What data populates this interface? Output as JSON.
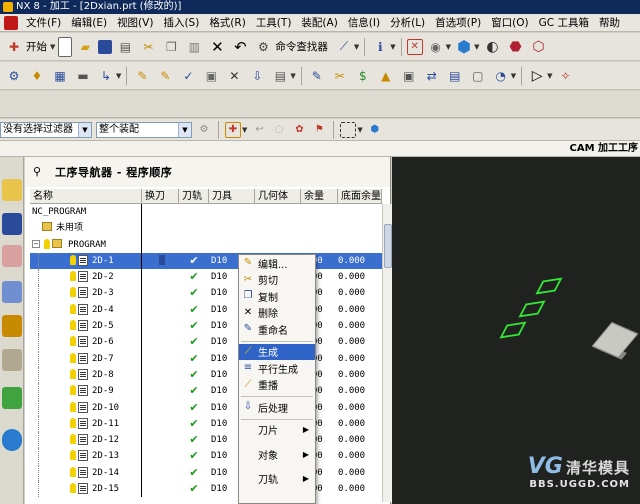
{
  "window": {
    "title": "NX 8 - 加工 - [2Dxian.prt (修改的)]"
  },
  "menubar": {
    "items": [
      "文件(F)",
      "编辑(E)",
      "视图(V)",
      "插入(S)",
      "格式(R)",
      "工具(T)",
      "装配(A)",
      "信息(I)",
      "分析(L)",
      "首选项(P)",
      "窗口(O)",
      "GC 工具箱",
      "帮助"
    ]
  },
  "toolbar": {
    "start_label": "开始",
    "command_finder_label": "命令查找器"
  },
  "filterbar": {
    "selection_filter": "没有选择过滤器",
    "assembly_scope": "整个装配"
  },
  "app_label": "CAM 加工工序",
  "navigator": {
    "title": "工序导航器 - 程序顺序",
    "columns": [
      "名称",
      "换刀",
      "刀轨",
      "刀具",
      "几何体",
      "余量",
      "底面余量"
    ],
    "root": "NC_PROGRAM",
    "unused": "未用项",
    "program": "PROGRAM",
    "operations": [
      {
        "name": "2D-1",
        "tool": "D10",
        "stock": "0000",
        "floor": "0.000"
      },
      {
        "name": "2D-2",
        "tool": "D10",
        "stock": "0000",
        "floor": "0.000"
      },
      {
        "name": "2D-3",
        "tool": "D10",
        "stock": "0000",
        "floor": "0.000"
      },
      {
        "name": "2D-4",
        "tool": "D10",
        "stock": "0000",
        "floor": "0.000"
      },
      {
        "name": "2D-5",
        "tool": "D10",
        "stock": "0000",
        "floor": "0.000"
      },
      {
        "name": "2D-6",
        "tool": "D10",
        "stock": "0000",
        "floor": "0.000"
      },
      {
        "name": "2D-7",
        "tool": "D10",
        "stock": "0000",
        "floor": "0.000"
      },
      {
        "name": "2D-8",
        "tool": "D10",
        "stock": "0000",
        "floor": "0.000"
      },
      {
        "name": "2D-9",
        "tool": "D10",
        "stock": "0000",
        "floor": "0.000"
      },
      {
        "name": "2D-10",
        "tool": "D10",
        "stock": "0000",
        "floor": "0.000"
      },
      {
        "name": "2D-11",
        "tool": "D10",
        "stock": "0000",
        "floor": "0.000"
      },
      {
        "name": "2D-12",
        "tool": "D10",
        "stock": "0000",
        "floor": "0.000"
      },
      {
        "name": "2D-13",
        "tool": "D10",
        "stock": "0000",
        "floor": "0.000"
      },
      {
        "name": "2D-14",
        "tool": "D10",
        "stock": "0000",
        "floor": "0.000"
      },
      {
        "name": "2D-15",
        "tool": "D10",
        "stock": "0000",
        "floor": "0.000"
      }
    ],
    "path_mark": "✔"
  },
  "context_menu": {
    "edit": "编辑...",
    "cut": "剪切",
    "copy": "复制",
    "delete": "删除",
    "rename": "重命名",
    "generate": "生成",
    "parallel_generate": "平行生成",
    "replay": "重播",
    "postprocess": "后处理",
    "tool_path": "刀片",
    "object": "对象",
    "cutter": "刀轨"
  },
  "watermark": {
    "logo": "VG",
    "brand": "清华模具",
    "url": "BBS.UGGD.COM"
  },
  "colors": {
    "title_bar": "#0f2a5a",
    "selection": "#3a6fd0",
    "menu_highlight": "#2f63c7",
    "path_ok": "#1a9a1a",
    "viewport_bg": "#202220",
    "geometry": "#35e635"
  }
}
